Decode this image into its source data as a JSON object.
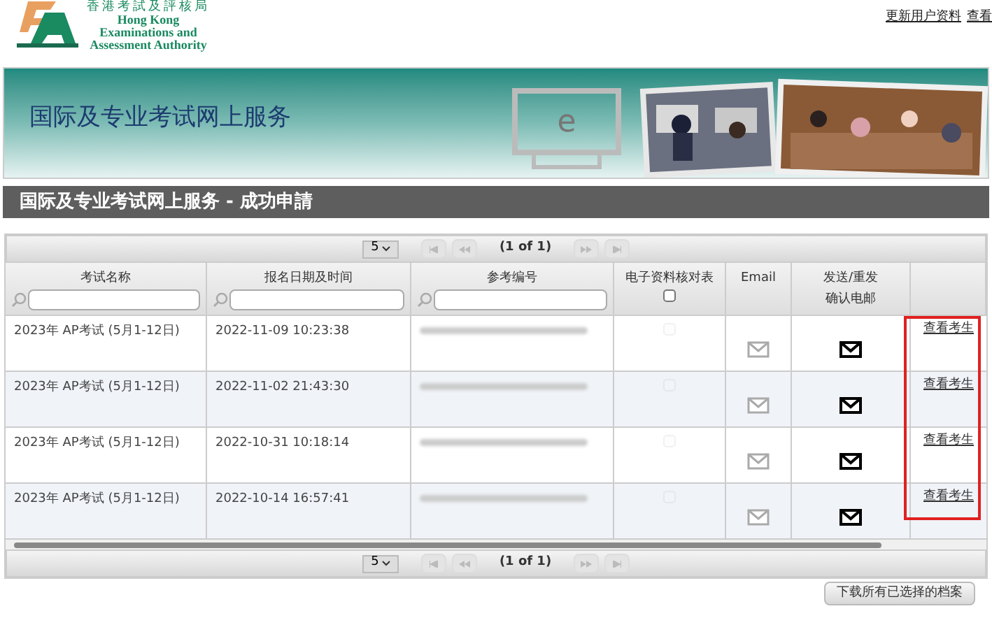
{
  "header": {
    "logo_chinese": "香港考試及評核局",
    "logo_english": [
      "Hong Kong",
      "Examinations and",
      "Assessment Authority"
    ],
    "links": [
      "更新用户资料",
      "查看"
    ]
  },
  "banner": {
    "title": "国际及专业考试网上服务",
    "monitor_letter": "e"
  },
  "section_title": "国际及专业考试网上服务 - 成功申請",
  "pagers": [
    {
      "page_size": "5",
      "page_info": "(1 of 1)"
    },
    {
      "page_size": "5",
      "page_info": "(1 of 1)"
    }
  ],
  "table": {
    "columns": [
      {
        "label": "考试名称",
        "filter": true
      },
      {
        "label": "报名日期及时间",
        "filter": true
      },
      {
        "label": "参考编号",
        "filter": true
      },
      {
        "label": "电子资料核对表",
        "checkbox": true,
        "checked": false
      },
      {
        "label": "Email"
      },
      {
        "label_lines": [
          "发送/重发",
          "确认电邮"
        ]
      },
      {}
    ],
    "rows": [
      {
        "exam": "2023年 AP考试 (5月1-12日)",
        "date": "2022-11-09 10:23:38",
        "checked": false,
        "email_enabled": false,
        "resend_enabled": true,
        "link": "查看考生"
      },
      {
        "exam": "2023年 AP考试 (5月1-12日)",
        "date": "2022-11-02 21:43:30",
        "checked": false,
        "email_enabled": false,
        "resend_enabled": true,
        "link": "查看考生"
      },
      {
        "exam": "2023年 AP考试 (5月1-12日)",
        "date": "2022-10-31 10:18:14",
        "checked": false,
        "email_enabled": false,
        "resend_enabled": true,
        "link": "查看考生"
      },
      {
        "exam": "2023年 AP考试 (5月1-12日)",
        "date": "2022-10-14 16:57:41",
        "checked": false,
        "email_enabled": false,
        "resend_enabled": true,
        "link": "查看考生"
      }
    ]
  },
  "download_button": "下载所有已选择的档案"
}
